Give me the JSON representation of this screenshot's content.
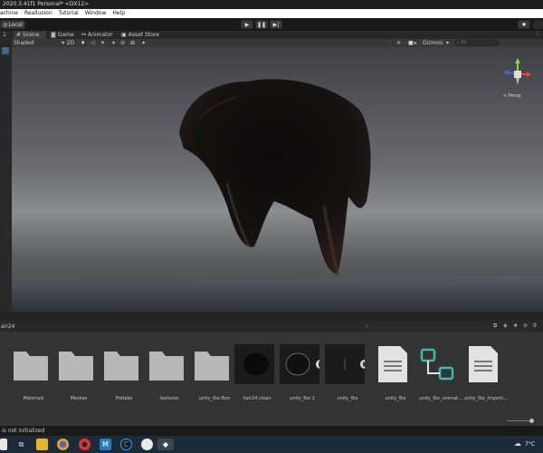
{
  "window": {
    "title": "2020.3.41f1 Personal* <DX12>"
  },
  "menu": {
    "items": [
      "achine",
      "Reallusion",
      "Tutorial",
      "Window",
      "Help"
    ]
  },
  "toolbar": {
    "pivot_label": "Local",
    "left_label": "1"
  },
  "tabs": [
    {
      "label": "Scene",
      "active": true
    },
    {
      "label": "Game",
      "active": false
    },
    {
      "label": "Animator",
      "active": false
    },
    {
      "label": "Asset Store",
      "active": false
    }
  ],
  "scene_tools": {
    "draw_mode": "Shaded",
    "mode_2d": "2D",
    "gizmos_label": "Gizmos",
    "search_placeholder": "All"
  },
  "gizmo": {
    "projection_label": "< Persp"
  },
  "project": {
    "breadcrumb": "air24",
    "icon_count": "9"
  },
  "assets": [
    {
      "name": "Materials",
      "kind": "folder"
    },
    {
      "name": "Meshes",
      "kind": "folder"
    },
    {
      "name": "Prefabs",
      "kind": "folder"
    },
    {
      "name": "textures",
      "kind": "folder"
    },
    {
      "name": "unity_fbx.fbm",
      "kind": "folder"
    },
    {
      "name": "hair24 clean",
      "kind": "model"
    },
    {
      "name": "unity_fbx 1",
      "kind": "model"
    },
    {
      "name": "unity_fbx",
      "kind": "model"
    },
    {
      "name": "unity_fbx",
      "kind": "file"
    },
    {
      "name": "unity_fbx_animat...",
      "kind": "animator"
    },
    {
      "name": "unity_fbx_Importi...",
      "kind": "file"
    }
  ],
  "status": {
    "text": "is not initialized"
  },
  "taskbar": {
    "temperature": "7°C"
  },
  "colors": {
    "menu_bg": "#ffffff",
    "viewport_sky": "#6a6a70",
    "gizmo_y": "#8dd33a",
    "gizmo_x": "#e64a3d",
    "gizmo_z": "#3d6ae6",
    "animator_teal": "#3fb8b0"
  }
}
